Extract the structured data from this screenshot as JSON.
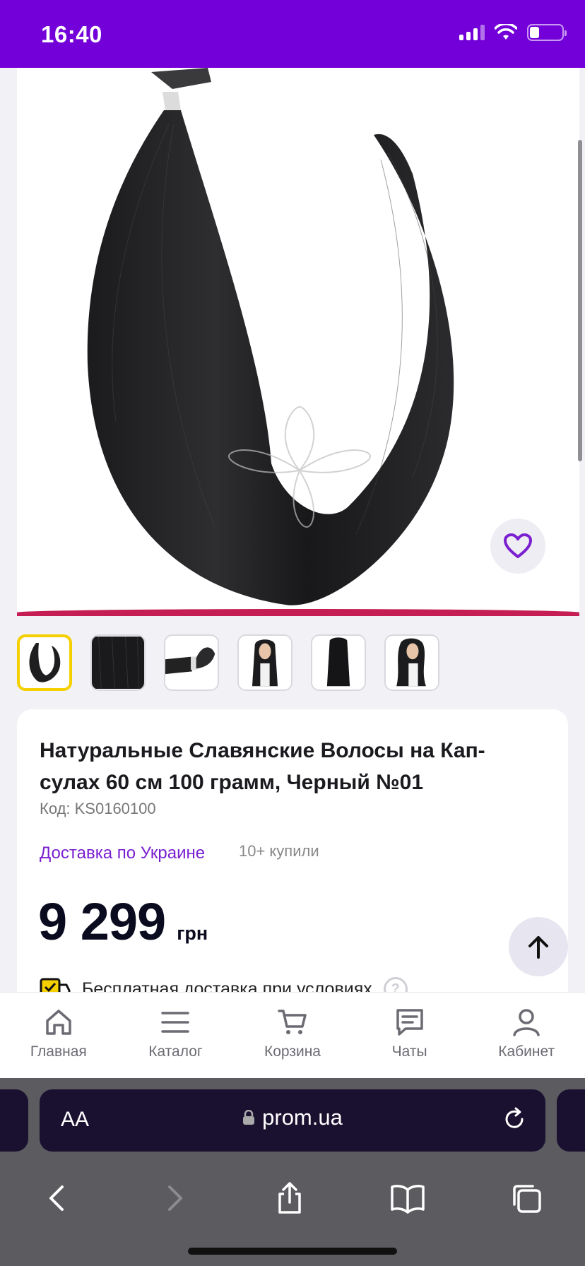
{
  "status": {
    "time": "16:40"
  },
  "product": {
    "title": "Натуральные Славянские Волосы на Кап-сулах 60 см 100 грамм, Черный №01",
    "code": "Код: KS0160100",
    "delivery": "Доставка по Украине",
    "bought": "10+ купили",
    "price": "9 299",
    "currency": "грн",
    "free_delivery": "Бесплатная доставка при условиях",
    "help": "?"
  },
  "icons": {
    "favorite": "heart-icon",
    "scroll_top": "arrow-up-icon"
  },
  "bottom_nav": {
    "home": "Главная",
    "catalog": "Каталог",
    "cart": "Корзина",
    "chats": "Чаты",
    "cabinet": "Кабинет"
  },
  "browser": {
    "aa": "AA",
    "url": "prom.ua"
  },
  "colors": {
    "brand": "#7400d9",
    "accent_link": "#7a1fd0",
    "thumb_active": "#f5d000"
  }
}
